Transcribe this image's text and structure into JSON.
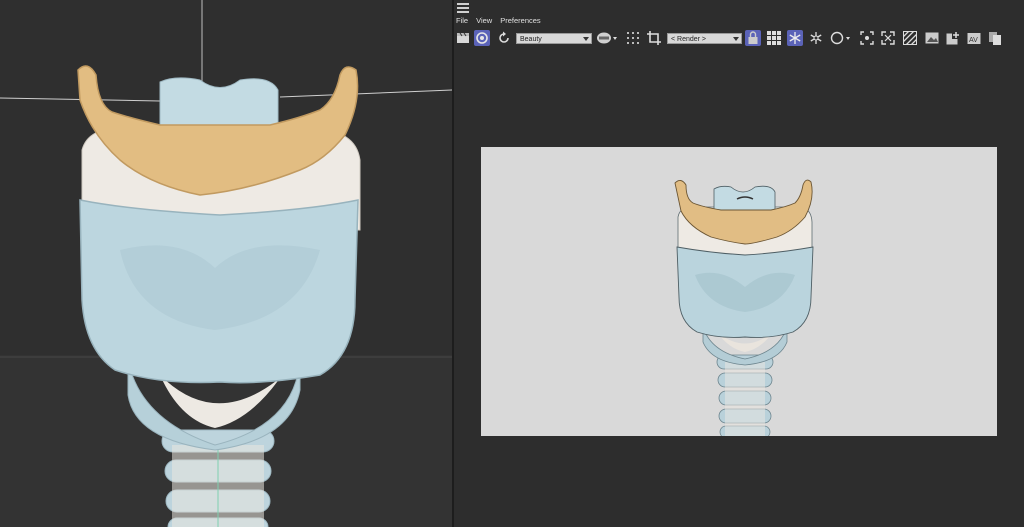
{
  "menu": {
    "file": "File",
    "view": "View",
    "preferences": "Preferences"
  },
  "toolbar": {
    "pass_dropdown": "Beauty",
    "render_dropdown": "< Render >"
  },
  "icons": {
    "hamburger": "menu-icon",
    "clapper": "clapperboard-icon",
    "ipr": "interactive-render-icon",
    "refresh": "refresh-icon",
    "rgb": "rgb-channel-icon",
    "grid_dots": "pixel-grid-icon",
    "crop": "crop-icon",
    "lock": "lock-icon",
    "grid": "grid-icon",
    "snowflake1": "snowflake-icon",
    "snowflake2": "snowflake-outline-icon",
    "circle": "circle-icon",
    "focus": "focus-region-icon",
    "expand": "expand-icon",
    "hatch": "stripes-icon",
    "image": "image-icon",
    "add_image": "add-image-icon",
    "av": "ab-compare-icon",
    "copy": "copy-icon"
  },
  "colors": {
    "accent": "#5b63b8",
    "cartilage": "#b9d3dc",
    "hyoid": "#e2bd82",
    "membrane": "#ece8e2"
  }
}
